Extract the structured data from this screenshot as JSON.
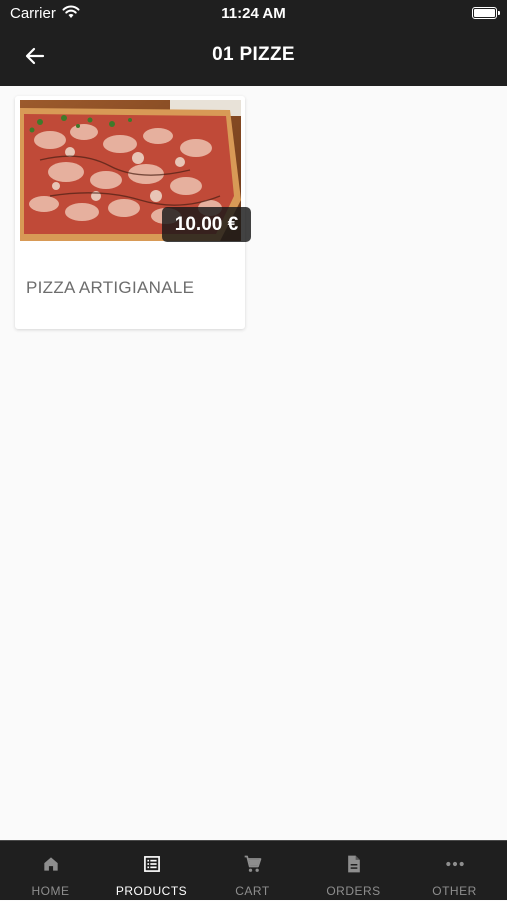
{
  "status_bar": {
    "carrier": "Carrier",
    "time": "11:24 AM"
  },
  "header": {
    "title": "01 PIZZE"
  },
  "products": [
    {
      "name": "PIZZA ARTIGIANALE",
      "price": "10.00 €"
    }
  ],
  "tab_bar": {
    "items": [
      {
        "label": "HOME",
        "icon": "home-icon"
      },
      {
        "label": "PRODUCTS",
        "icon": "list-icon",
        "active": true
      },
      {
        "label": "CART",
        "icon": "cart-icon"
      },
      {
        "label": "ORDERS",
        "icon": "document-icon"
      },
      {
        "label": "OTHER",
        "icon": "more-icon"
      }
    ]
  },
  "colors": {
    "bar_background": "#1f1f1f",
    "page_background": "#fafafa",
    "active_tab": "#ffffff",
    "inactive_tab": "#8e8e8e"
  }
}
